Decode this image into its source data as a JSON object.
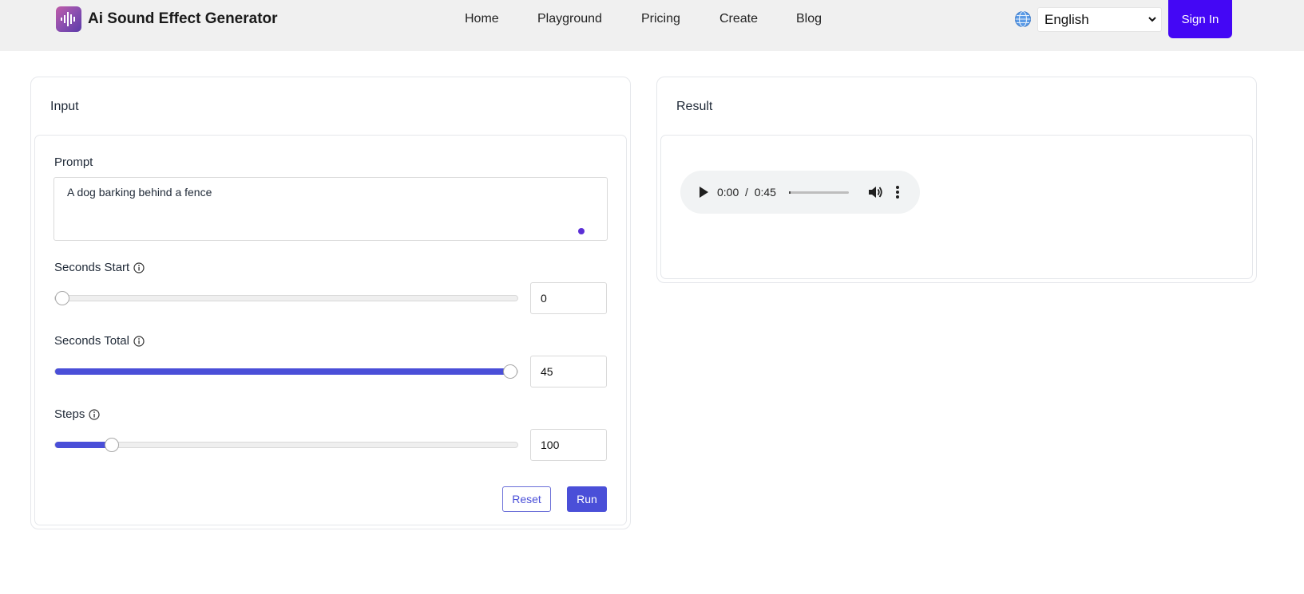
{
  "header": {
    "brand": "Ai Sound Effect Generator",
    "nav": [
      "Home",
      "Playground",
      "Pricing",
      "Create",
      "Blog"
    ],
    "language": "English",
    "sign_in": "Sign In"
  },
  "input_panel": {
    "title": "Input",
    "prompt_label": "Prompt",
    "prompt_value": "A dog barking behind a fence",
    "seconds_start": {
      "label": "Seconds Start",
      "value": "0",
      "level": 0.0
    },
    "seconds_total": {
      "label": "Seconds Total",
      "value": "45",
      "level": 1.0
    },
    "steps": {
      "label": "Steps",
      "value": "100",
      "level": 0.11
    },
    "reset_label": "Reset",
    "run_label": "Run"
  },
  "result_panel": {
    "title": "Result",
    "audio": {
      "current_time": "0:00",
      "duration": "0:45"
    }
  },
  "colors": {
    "accent": "#4a4fd8",
    "sign_in_bg": "#4407f5",
    "header_bg": "#f0f0f0"
  }
}
